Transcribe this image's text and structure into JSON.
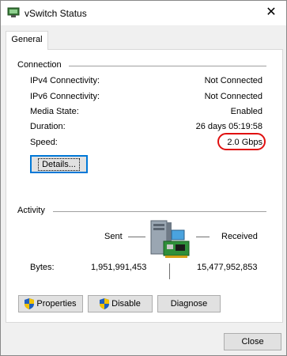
{
  "window": {
    "title": "vSwitch Status",
    "close_glyph": "✕",
    "icon": "network-adapter-icon"
  },
  "tabs": [
    {
      "label": "General",
      "selected": true
    }
  ],
  "connection": {
    "heading": "Connection",
    "rows": [
      {
        "label": "IPv4 Connectivity:",
        "value": "Not Connected"
      },
      {
        "label": "IPv6 Connectivity:",
        "value": "Not Connected"
      },
      {
        "label": "Media State:",
        "value": "Enabled"
      },
      {
        "label": "Duration:",
        "value": "26 days 05:19:58"
      },
      {
        "label": "Speed:",
        "value": "2.0 Gbps"
      }
    ],
    "details_label": "Details..."
  },
  "activity": {
    "heading": "Activity",
    "sent_label": "Sent",
    "received_label": "Received",
    "bytes_label": "Bytes:",
    "bytes_sent": "1,951,991,453",
    "bytes_received": "15,477,952,853"
  },
  "buttons": {
    "properties": "Properties",
    "disable": "Disable",
    "diagnose": "Diagnose",
    "close": "Close"
  },
  "colors": {
    "highlight_ring": "#e01010",
    "focus_border": "#0078d7"
  }
}
